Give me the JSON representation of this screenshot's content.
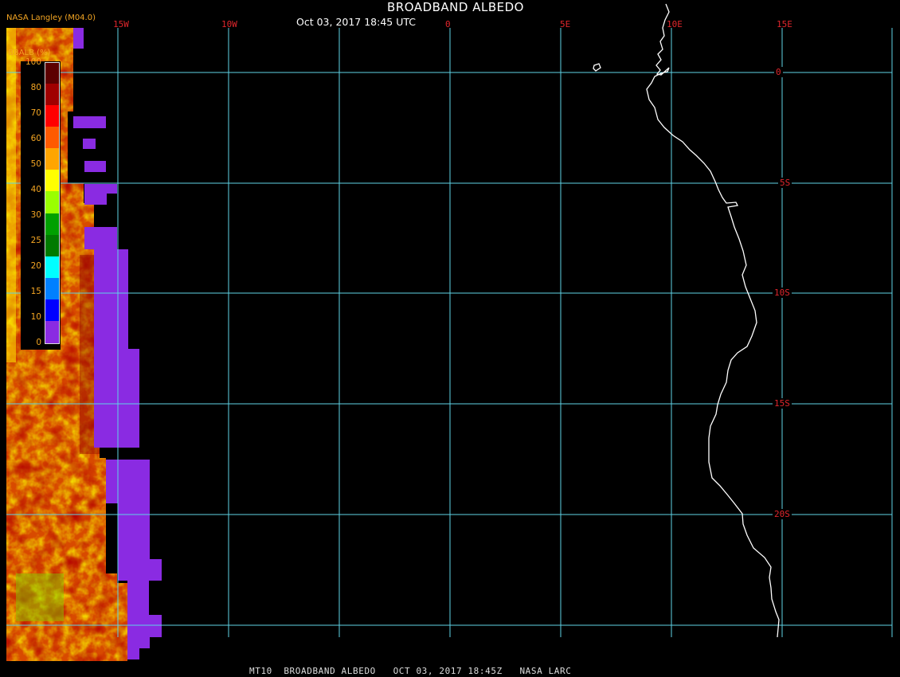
{
  "header": {
    "title": "BROADBAND ALBEDO",
    "timestamp": "Oct 03, 2017 18:45 UTC",
    "credit": "NASA Langley (M04.0)"
  },
  "footer": {
    "caption": "MT10  BROADBAND ALBEDO   OCT 03, 2017 18:45Z   NASA LARC"
  },
  "legend": {
    "title": "BBALB (%)",
    "ticks": [
      "100",
      "80",
      "70",
      "60",
      "50",
      "40",
      "30",
      "25",
      "20",
      "15",
      "10",
      "0"
    ],
    "colors": [
      "#5c0000",
      "#a00000",
      "#ff0000",
      "#ff5a00",
      "#ffa500",
      "#ffff00",
      "#9aff00",
      "#00a000",
      "#007a00",
      "#00ffff",
      "#0080ff",
      "#0000ff",
      "#8a2be2"
    ]
  },
  "grid": {
    "color": "#5fd3e6",
    "longitudes": [
      "15W",
      "10W",
      "0",
      "5E",
      "10E",
      "15E"
    ],
    "latitudes": [
      "0",
      "5S",
      "10S",
      "15S",
      "20S"
    ]
  },
  "layers": {
    "coastline_color": "#ffffff",
    "nodata_color": "#8a2be2"
  }
}
